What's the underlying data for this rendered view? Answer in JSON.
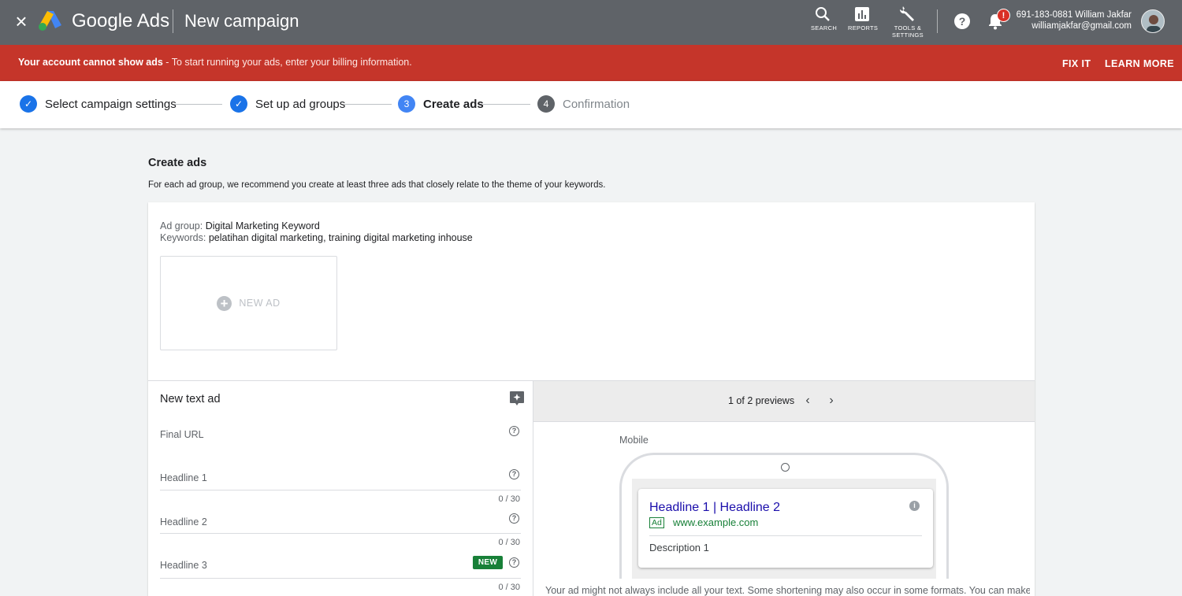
{
  "topbar": {
    "close_glyph": "×",
    "brand": "Google Ads",
    "title": "New campaign",
    "tools": [
      {
        "label": "SEARCH",
        "icon": "search-icon"
      },
      {
        "label": "REPORTS",
        "icon": "reports-icon"
      },
      {
        "label": "TOOLS &",
        "label2": "SETTINGS",
        "icon": "wrench-icon"
      }
    ],
    "notification_count": "!",
    "account": {
      "line1": "691-183-0881 William Jakfar",
      "line2": "williamjakfar@gmail.com"
    }
  },
  "alert": {
    "bold": "Your account cannot show ads",
    "rest": " - To start running your ads, enter your billing information.",
    "fix": "FIX IT",
    "learn": "LEARN MORE"
  },
  "steps": [
    {
      "label": "Select campaign settings",
      "state": "done",
      "glyph": "✓"
    },
    {
      "label": "Set up ad groups",
      "state": "done",
      "glyph": "✓"
    },
    {
      "label": "Create ads",
      "state": "active",
      "glyph": "3"
    },
    {
      "label": "Confirmation",
      "state": "pending",
      "glyph": "4"
    }
  ],
  "section": {
    "title": "Create ads",
    "desc": "For each ad group, we recommend you create at least three ads that closely relate to the theme of your keywords."
  },
  "adgroup": {
    "group_key": "Ad group: ",
    "group_val": "Digital Marketing Keyword",
    "keywords_key": "Keywords: ",
    "keywords_val": "pelatihan digital marketing, training digital marketing inhouse",
    "new_ad_label": "NEW AD",
    "plus_glyph": "+"
  },
  "form": {
    "title": "New text ad",
    "final_url_label": "Final URL",
    "headline1_label": "Headline 1",
    "headline2_label": "Headline 2",
    "headline3_label": "Headline 3",
    "new_badge": "NEW",
    "counter": "0 / 30",
    "help_glyph": "?"
  },
  "preview": {
    "pager": "1 of 2 previews",
    "prev": "‹",
    "next": "›",
    "device": "Mobile",
    "headline": "Headline 1 | Headline 2",
    "ad_tag": "Ad",
    "url": "www.example.com",
    "description": "Description 1",
    "info_glyph": "i",
    "note": "Your ad might not always include all your text. Some shortening may also occur in some formats. You can make"
  },
  "colors": {
    "topbar": "#5f6368",
    "alert": "#c5352a",
    "step_done": "#1a73e8",
    "headline_link": "#1a0dab",
    "ad_green": "#188038"
  }
}
